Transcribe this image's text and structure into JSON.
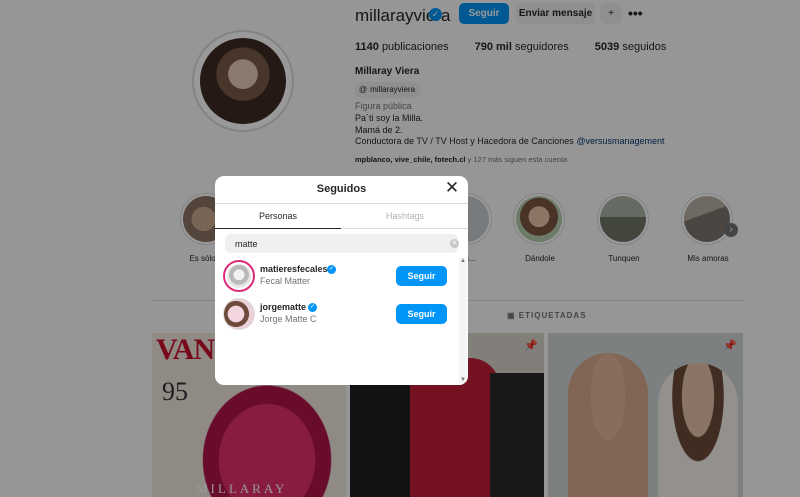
{
  "profile": {
    "username": "millarayviera",
    "follow_label": "Seguir",
    "message_label": "Enviar mensaje",
    "adduser_icon": "person-plus-icon",
    "more_icon": "more-horizontal-icon",
    "stats": {
      "posts_count": "1140",
      "posts_label": "publicaciones",
      "followers_count": "790 mil",
      "followers_label": "seguidores",
      "following_count": "5039",
      "following_label": "seguidos"
    },
    "full_name": "Millaray Viera",
    "threads_handle": "millarayviera",
    "category": "Figura pública",
    "bio_line1": "Pa´ti soy la Milla.",
    "bio_line2": "Mamá de 2.",
    "bio_line3": "Conductora de TV / TV Host y Hacedora de Canciones",
    "bio_link": "@versusmanagement",
    "followed_by_names": "mpblanco, vive_chile, fotech.cl",
    "followed_by_rest": "y 127 más siguen esta cuenta"
  },
  "highlights": [
    {
      "label": "Es sólo m"
    },
    {
      "label": "Ch..."
    },
    {
      "label": "Dándole"
    },
    {
      "label": "Tunquen"
    },
    {
      "label": "Mis amoras"
    }
  ],
  "tabs": {
    "tagged_label": "ETIQUETADAS"
  },
  "posts": {
    "vanity_title": "VAN",
    "vanity_number": "95",
    "vanity_name": "MILLARAY"
  },
  "modal": {
    "title": "Seguidos",
    "tab_people": "Personas",
    "tab_hashtags": "Hashtags",
    "search_value": "matte",
    "results": [
      {
        "username": "matieresfecales",
        "name": "Fecal Matter",
        "follow_label": "Seguir"
      },
      {
        "username": "jorgematte",
        "name": "Jorge Matte C",
        "follow_label": "Seguir"
      }
    ]
  },
  "colors": {
    "accent": "#0095f6",
    "overlay": "rgba(0,0,0,0.4)"
  }
}
